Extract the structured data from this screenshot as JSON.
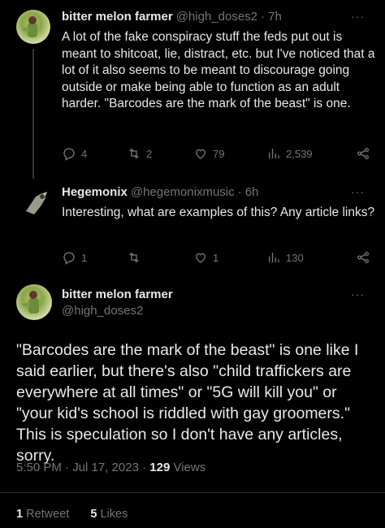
{
  "tweet1": {
    "name": "bitter melon farmer",
    "handle": "@high_doses2",
    "time": "· 7h",
    "text": "A lot of the fake conspiracy stuff the feds put out is meant to shitcoat, lie, distract, etc. but I've noticed that a lot of it also seems to be meant to discourage going outside or make being able to function as an adult harder. \"Barcodes are the mark of the beast\" is one.",
    "replies": "4",
    "retweets": "2",
    "likes": "79",
    "views": "2,539"
  },
  "tweet2": {
    "name": "Hegemonix",
    "handle": "@hegemonixmusic",
    "time": "· 6h",
    "text": "Interesting, what are examples of this? Any article links?",
    "replies": "1",
    "retweets": "",
    "likes": "1",
    "views": "130"
  },
  "tweet3": {
    "name": "bitter melon farmer",
    "handle": "@high_doses2",
    "text": "\"Barcodes are the mark of the beast\" is one like I said earlier, but there's also \"child traffickers are everywhere at all times\" or \"5G will kill you\" or \"your kid's school is riddled with gay groomers.\" This is speculation so I don't have any articles, sorry.",
    "timestamp": "5:50 PM · Jul 17, 2023 ·",
    "views_count": "129",
    "views_label": "Views",
    "retweet_count": "1",
    "retweet_label": "Retweet",
    "like_count": "5",
    "like_label": "Likes"
  },
  "more_icon": "···",
  "icons": [
    "reply-icon",
    "retweet-icon",
    "like-icon",
    "views-icon",
    "share-icon",
    "more-icon"
  ]
}
